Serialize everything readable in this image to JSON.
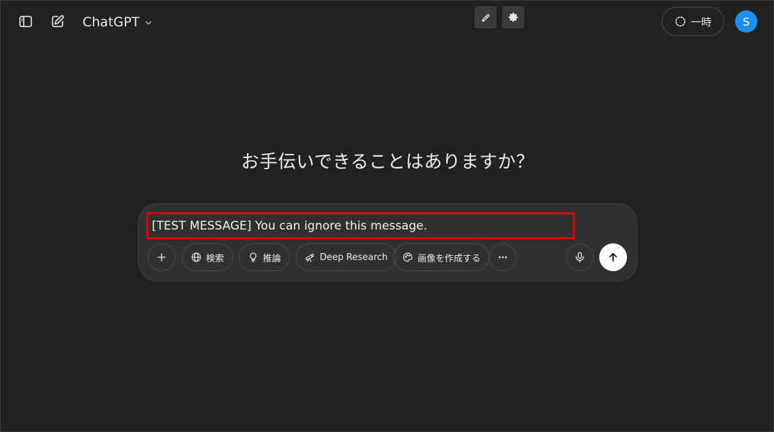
{
  "header": {
    "model_name": "ChatGPT",
    "temporary_label": "一時",
    "avatar_initial": "S"
  },
  "main": {
    "greeting": "お手伝いできることはありますか？"
  },
  "composer": {
    "value": "[TEST MESSAGE] You can ignore this message.",
    "tools": {
      "search": "検索",
      "reason": "推論",
      "deep_research": "Deep Research",
      "create_image": "画像を作成する"
    }
  },
  "colors": {
    "background": "#212121",
    "composer_bg": "#303030",
    "highlight_border": "#e00000",
    "avatar_bg": "#1e8ef0",
    "send_bg": "#ffffff"
  },
  "icons": [
    "sidebar-toggle-icon",
    "new-chat-icon",
    "chevron-down-icon",
    "brush-icon",
    "gear-icon",
    "temporary-chat-icon",
    "plus-icon",
    "globe-icon",
    "lightbulb-icon",
    "telescope-icon",
    "palette-icon",
    "more-icon",
    "microphone-icon",
    "arrow-up-icon"
  ]
}
